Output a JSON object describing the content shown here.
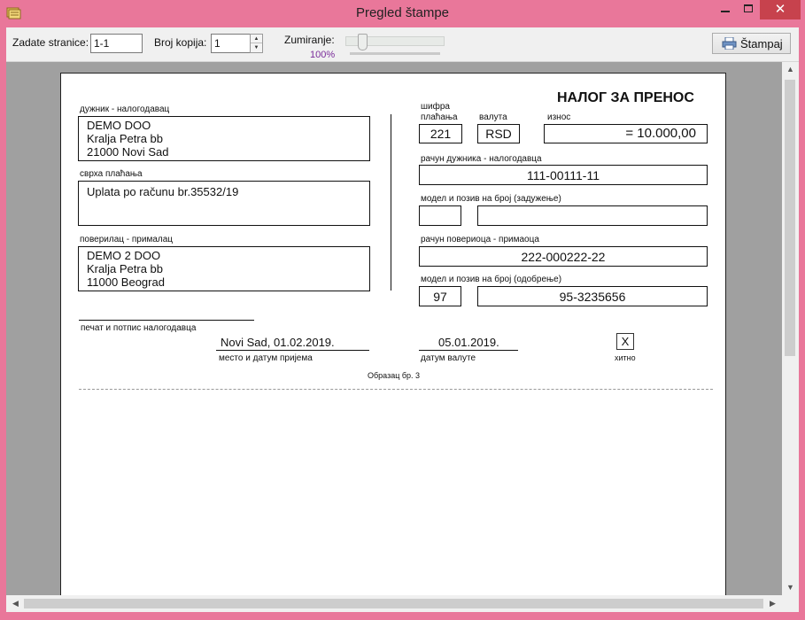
{
  "window": {
    "title": "Pregled štampe",
    "minimize": "",
    "maximize": "",
    "close": "✕"
  },
  "toolbar": {
    "pages_label": "Zadate stranice:",
    "pages_value": "1-1",
    "copies_label": "Broj kopija:",
    "copies_value": "1",
    "zoom_label": "Zumiranje:",
    "zoom_value": "100%",
    "zoom_level_percent": 100,
    "print_label": "Štampaj"
  },
  "form": {
    "title": "НАЛОГ ЗА ПРЕНОС",
    "debtor_label": "дужник - налогодавац",
    "debtor_lines": [
      "DEMO DOO",
      "Kralja Petra bb",
      "21000 Novi Sad"
    ],
    "purpose_label": "сврха плаћања",
    "purpose": "Uplata po računu br.35532/19",
    "creditor_label": "поверилац - прималац",
    "creditor_lines": [
      "DEMO 2 DOO",
      "Kralja Petra bb",
      "11000 Beograd"
    ],
    "payment_code_label_1": "шифра",
    "payment_code_label_2": "плаћања",
    "payment_code": "221",
    "currency_label": "валута",
    "currency": "RSD",
    "amount_label": "износ",
    "amount": "= 10.000,00",
    "debtor_account_label": "рачун дужника - налогодавца",
    "debtor_account": "111-00111-11",
    "debit_model_label": "модел и позив на број (задужење)",
    "debit_model": "",
    "debit_reference": "",
    "creditor_account_label": "рачун повериоца - примаоца",
    "creditor_account": "222-000222-22",
    "credit_model_label": "модел и позив на број (одобрење)",
    "credit_model": "97",
    "credit_reference": "95-3235656",
    "signature_label": "печат и потпис налогодавца",
    "place_date": "Novi Sad, 01.02.2019.",
    "place_date_label": "место и датум пријема",
    "value_date": "05.01.2019.",
    "value_date_label": "датум валуте",
    "urgent_mark": "X",
    "urgent_label": "хитно",
    "form_number": "Образац бр. 3"
  },
  "scroll": {
    "up": "▲",
    "down": "▼",
    "left": "◀",
    "right": "▶"
  }
}
